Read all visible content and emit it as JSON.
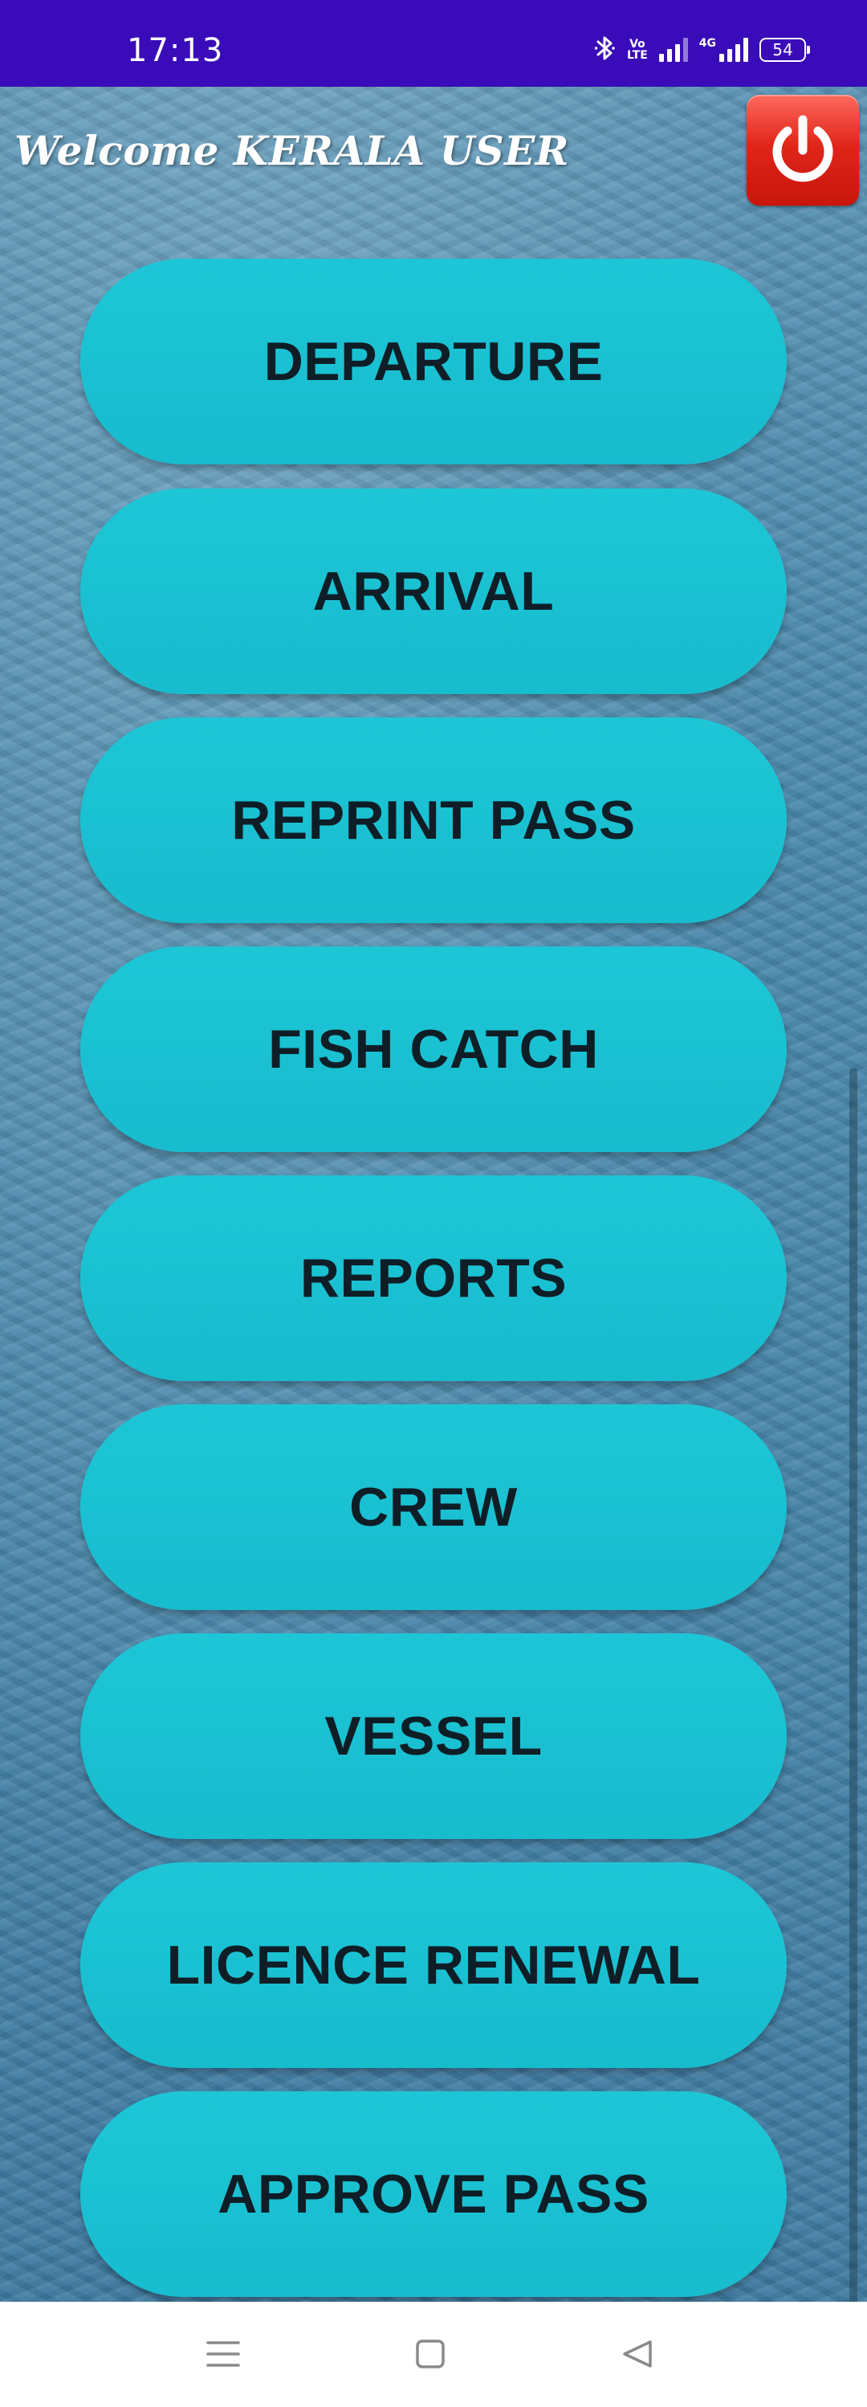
{
  "status_bar": {
    "time": "17:13",
    "volte_label_top": "Vo",
    "volte_label_bottom": "LTE",
    "network_label": "4G",
    "battery": "54",
    "bg_color": "#3a0bb8",
    "icons": [
      "bluetooth-icon",
      "volte-icon",
      "signal-icon",
      "signal-4g-icon",
      "battery-icon"
    ]
  },
  "header": {
    "welcome_text": "Welcome KERALA USER",
    "power_icon": "power-icon",
    "power_color": "#e0261a"
  },
  "menu": {
    "button_color": "#1dc6d6",
    "items": [
      {
        "label": "DEPARTURE"
      },
      {
        "label": "ARRIVAL"
      },
      {
        "label": "REPRINT PASS"
      },
      {
        "label": "FISH CATCH"
      },
      {
        "label": "REPORTS"
      },
      {
        "label": "CREW"
      },
      {
        "label": "VESSEL"
      },
      {
        "label": "LICENCE RENEWAL"
      },
      {
        "label": "APPROVE PASS"
      }
    ]
  },
  "nav_bar": {
    "icons": [
      "menu-icon",
      "home-icon",
      "back-icon"
    ]
  }
}
